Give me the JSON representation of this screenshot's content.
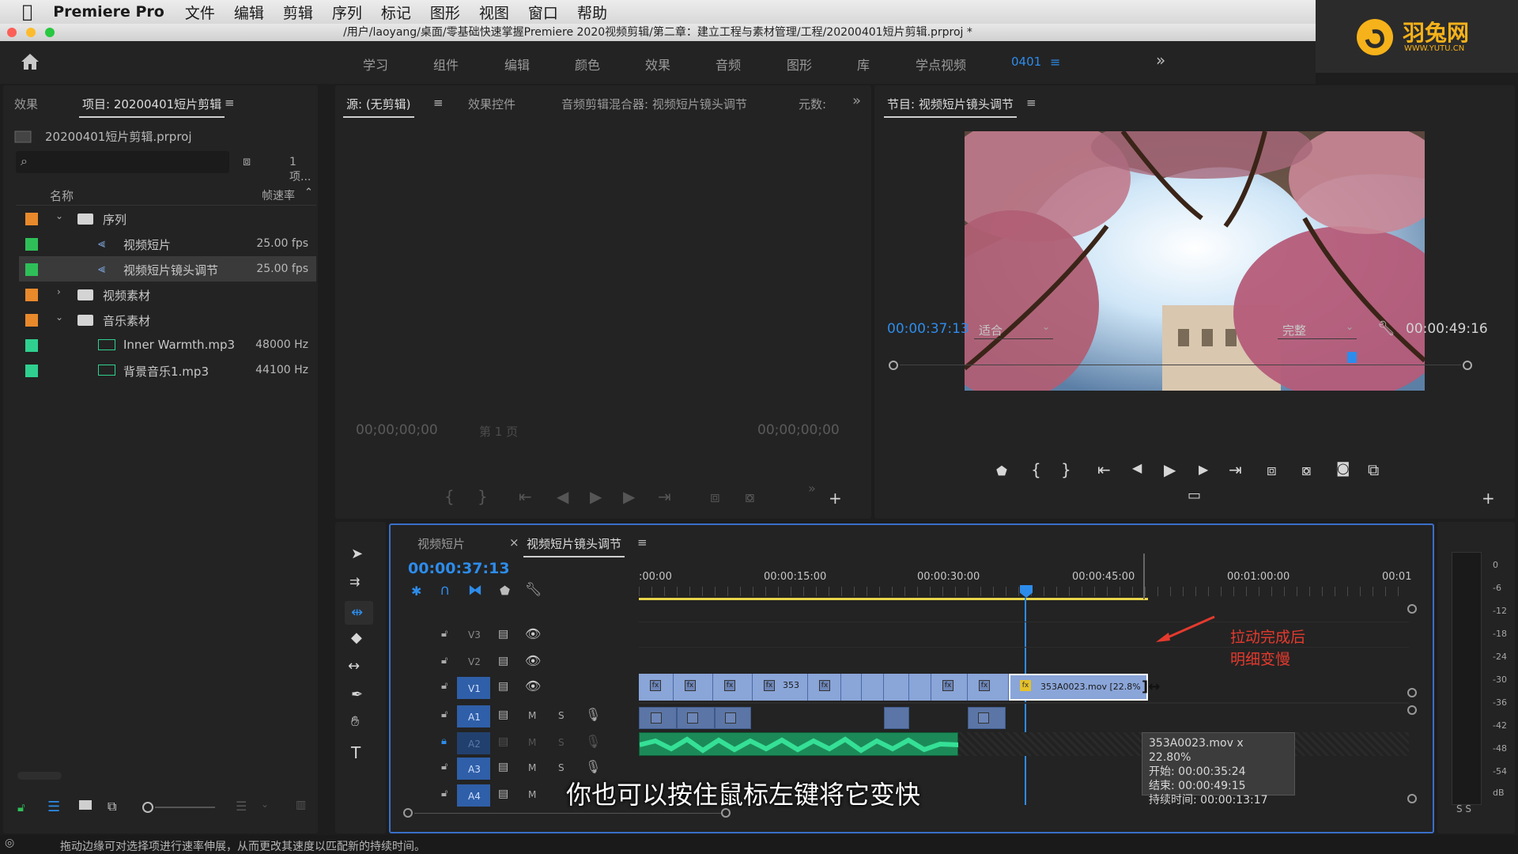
{
  "menubar": {
    "app_name": "Premiere Pro",
    "items": [
      "文件",
      "编辑",
      "剪辑",
      "序列",
      "标记",
      "图形",
      "视图",
      "窗口",
      "帮助"
    ]
  },
  "titlebar": {
    "path": "/用户/laoyang/桌面/零基础快速掌握Premiere 2020视频剪辑/第二章：建立工程与素材管理/工程/20200401短片剪辑.prproj *"
  },
  "logo": {
    "name": "羽兔网",
    "url_text": "WWW.YUTU.CN"
  },
  "workspaces": {
    "items": [
      "学习",
      "组件",
      "编辑",
      "颜色",
      "效果",
      "音频",
      "图形",
      "库",
      "学点视频"
    ],
    "active": "0401",
    "more": "»"
  },
  "project_panel": {
    "tabs": [
      "效果",
      "项目: 20200401短片剪辑"
    ],
    "file_name": "20200401短片剪辑.prproj",
    "item_count": "1 项...",
    "col_name": "名称",
    "col_rate": "帧速率",
    "rows": [
      {
        "name": "序列",
        "rate": "",
        "color": "#e8892c"
      },
      {
        "name": "视频短片",
        "rate": "25.00 fps",
        "color": "#2fbf59"
      },
      {
        "name": "视频短片镜头调节",
        "rate": "25.00 fps",
        "color": "#2fbf59"
      },
      {
        "name": "视频素材",
        "rate": "",
        "color": "#e8892c"
      },
      {
        "name": "音乐素材",
        "rate": "",
        "color": "#e8892c"
      },
      {
        "name": "Inner Warmth.mp3",
        "rate": "48000 Hz",
        "color": "#2fd08f"
      },
      {
        "name": "背景音乐1.mp3",
        "rate": "44100 Hz",
        "color": "#2fd08f"
      }
    ]
  },
  "source_panel": {
    "tabs": [
      "源: (无剪辑)",
      "效果控件",
      "音频剪辑混合器: 视频短片镜头调节",
      "元数:"
    ],
    "tc_left": "00;00;00;00",
    "tc_right": "00;00;00;00",
    "page": "第 1 页"
  },
  "program_panel": {
    "tab": "节目: 视频短片镜头调节",
    "timecode": "00:00:37:13",
    "fit": "适合",
    "quality": "完整",
    "duration": "00:00:49:16"
  },
  "timeline": {
    "tabs": [
      "视频短片",
      "视频短片镜头调节"
    ],
    "timecode": "00:00:37:13",
    "ruler": [
      ":00:00",
      "00:00:15:00",
      "00:00:30:00",
      "00:00:45:00",
      "00:01:00:00",
      "00:01"
    ],
    "tracks": [
      "V3",
      "V2",
      "V1",
      "A1",
      "A2",
      "A3",
      "A4"
    ],
    "clip_label_short": "353",
    "clip_label": "353A0023.mov [22.8%",
    "annotation_line1": "拉动完成后",
    "annotation_line2": "明细变慢",
    "tooltip": {
      "line1": "353A0023.mov x 22.80%",
      "line2": "开始: 00:00:35:24",
      "line3": "结束: 00:00:49:15",
      "line4": "持续时间: 00:00:13:17"
    },
    "subtitle": "你也可以按住鼠标左键将它变快"
  },
  "meter": {
    "labels": [
      "0",
      "-6",
      "-12",
      "-18",
      "-24",
      "-30",
      "-36",
      "-42",
      "-48",
      "-54",
      "dB"
    ],
    "solo": "S S"
  },
  "statusbar": {
    "text": "拖动边缘可对选择项进行速率伸展，从而更改其速度以匹配新的持续时间。"
  }
}
